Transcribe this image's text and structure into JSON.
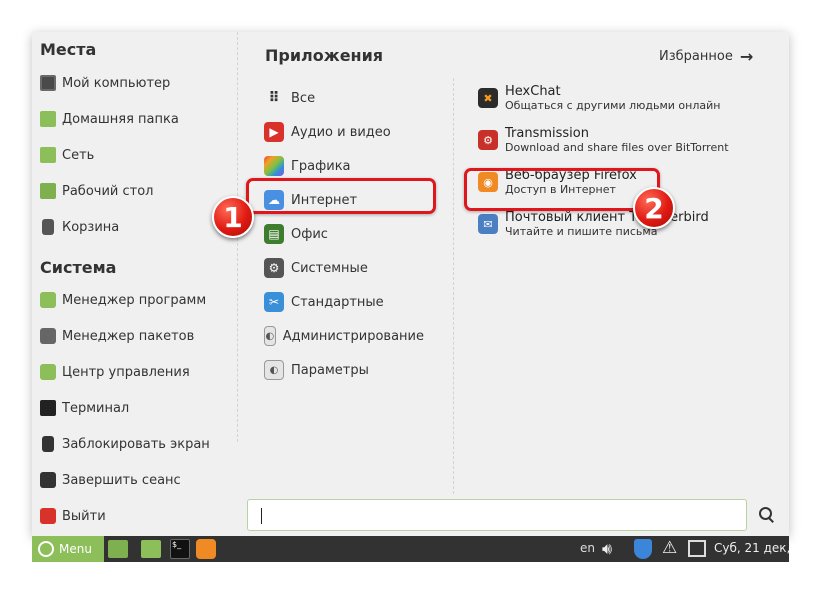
{
  "places": {
    "title": "Места",
    "items": [
      {
        "label": "Мой компьютер"
      },
      {
        "label": "Домашняя папка"
      },
      {
        "label": "Сеть"
      },
      {
        "label": "Рабочий стол"
      },
      {
        "label": "Корзина"
      }
    ]
  },
  "system": {
    "title": "Система",
    "items": [
      {
        "label": "Менеджер программ"
      },
      {
        "label": "Менеджер пакетов"
      },
      {
        "label": "Центр управления"
      },
      {
        "label": "Терминал"
      },
      {
        "label": "Заблокировать экран"
      },
      {
        "label": "Завершить сеанс"
      },
      {
        "label": "Выйти"
      }
    ]
  },
  "applications": {
    "title": "Приложения",
    "favorites_label": "Избранное",
    "categories": [
      {
        "label": "Все"
      },
      {
        "label": "Аудио и видео"
      },
      {
        "label": "Графика"
      },
      {
        "label": "Интернет"
      },
      {
        "label": "Офис"
      },
      {
        "label": "Системные"
      },
      {
        "label": "Стандартные"
      },
      {
        "label": "Администрирование"
      },
      {
        "label": "Параметры"
      }
    ],
    "apps": [
      {
        "name": "HexChat",
        "description": "Общаться с другими людьми онлайн"
      },
      {
        "name": "Transmission",
        "description": "Download and share files over BitTorrent"
      },
      {
        "name": "Веб-браузер Firefox",
        "description": "Доступ в Интернет"
      },
      {
        "name": "Почтовый клиент Thunderbird",
        "description": "Читайте и пишите письма"
      }
    ]
  },
  "search": {
    "value": ""
  },
  "taskbar": {
    "menu_label": "Menu",
    "language": "en",
    "clock": "Суб, 21 дек,"
  },
  "annotations": {
    "step1": "1",
    "step2": "2"
  },
  "colors": {
    "highlight": "#e0161d",
    "mint_green": "#8cbf5a",
    "panel": "#323232"
  }
}
